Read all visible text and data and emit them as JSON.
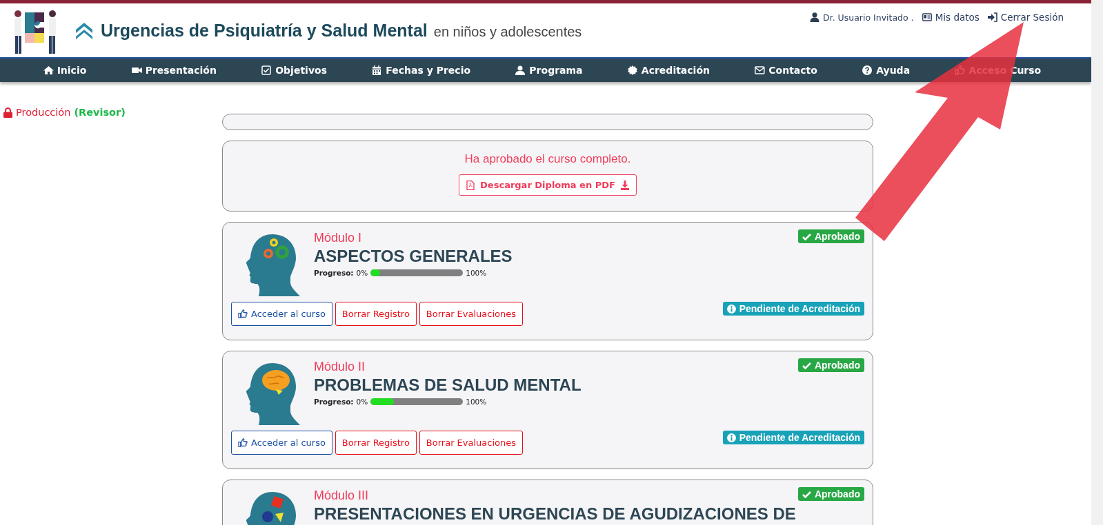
{
  "header": {
    "title": "Urgencias de Psiquiatría y Salud Mental",
    "subtitle": "en niños y adolescentes",
    "user": "Dr. Usuario Invitado .",
    "links": [
      "Mis datos",
      "Cerrar Sesión"
    ]
  },
  "nav": [
    {
      "label": "Inicio"
    },
    {
      "label": "Presentación"
    },
    {
      "label": "Objetivos"
    },
    {
      "label": "Fechas y Precio"
    },
    {
      "label": "Programa"
    },
    {
      "label": "Acreditación"
    },
    {
      "label": "Contacto"
    },
    {
      "label": "Ayuda"
    },
    {
      "label": "Acceso Curso"
    }
  ],
  "mode": {
    "label": "Producción",
    "role": "(Revisor)"
  },
  "notice": {
    "message": "Ha aprobado el curso completo.",
    "button": "Descargar Diploma en PDF"
  },
  "modules": [
    {
      "number": "Módulo I",
      "title": "ASPECTOS GENERALES",
      "status": "Aprobado",
      "progress_label": "Progreso:",
      "start": "0%",
      "level": 0.1,
      "end": "100%",
      "buttons": [
        "Acceder al curso",
        "Borrar Registro",
        "Borrar Evaluaciones"
      ],
      "accreditation": "Pendiente de Acreditación"
    },
    {
      "number": "Módulo II",
      "title": "PROBLEMAS DE SALUD MENTAL",
      "status": "Aprobado",
      "progress_label": "Progreso:",
      "start": "0%",
      "level": 0.25,
      "end": "100%",
      "buttons": [
        "Acceder al curso",
        "Borrar Registro",
        "Borrar Evaluaciones"
      ],
      "accreditation": "Pendiente de Acreditación"
    },
    {
      "number": "Módulo III",
      "title": "PRESENTACIONES EN URGENCIAS DE AGUDIZACIONES DE",
      "status": "Aprobado"
    }
  ]
}
